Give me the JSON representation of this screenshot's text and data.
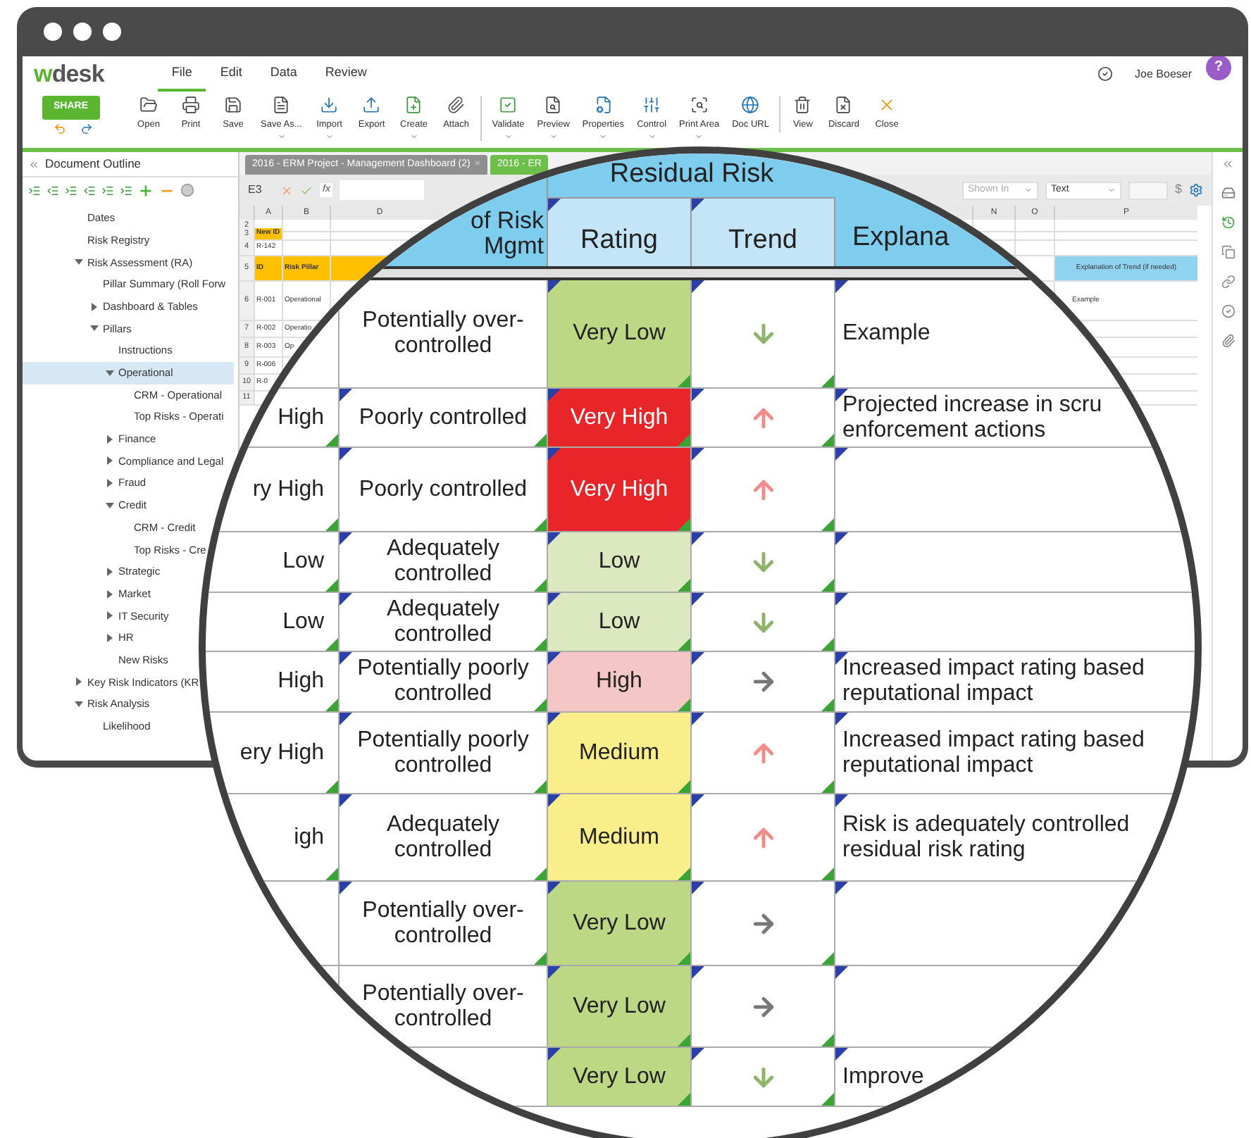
{
  "app": {
    "logo": {
      "accent": "w",
      "rest": "desk"
    },
    "menu": [
      {
        "label": "File",
        "selected": true
      },
      {
        "label": "Edit",
        "selected": false
      },
      {
        "label": "Data",
        "selected": false
      },
      {
        "label": "Review",
        "selected": false
      }
    ],
    "user": "Joe Boeser",
    "help": "?"
  },
  "toolbar": {
    "share": "SHARE",
    "tools": [
      {
        "label": "Open",
        "dropdown": false,
        "separator_before": false
      },
      {
        "label": "Print",
        "dropdown": false,
        "separator_before": false
      },
      {
        "label": "Save",
        "dropdown": false,
        "separator_before": false
      },
      {
        "label": "Save As...",
        "dropdown": true,
        "separator_before": false
      },
      {
        "label": "Import",
        "dropdown": true,
        "separator_before": false
      },
      {
        "label": "Export",
        "dropdown": false,
        "separator_before": false
      },
      {
        "label": "Create",
        "dropdown": true,
        "separator_before": false
      },
      {
        "label": "Attach",
        "dropdown": false,
        "separator_before": false
      },
      {
        "label": "Validate",
        "dropdown": true,
        "separator_before": true
      },
      {
        "label": "Preview",
        "dropdown": true,
        "separator_before": false
      },
      {
        "label": "Properties",
        "dropdown": true,
        "separator_before": false
      },
      {
        "label": "Control",
        "dropdown": true,
        "separator_before": false
      },
      {
        "label": "Print Area",
        "dropdown": true,
        "separator_before": false
      },
      {
        "label": "Doc URL",
        "dropdown": false,
        "separator_before": false
      },
      {
        "label": "View",
        "dropdown": false,
        "separator_before": true
      },
      {
        "label": "Discard",
        "dropdown": false,
        "separator_before": false
      },
      {
        "label": "Close",
        "dropdown": false,
        "separator_before": false
      }
    ]
  },
  "outline": {
    "title": "Document Outline",
    "items": [
      {
        "label": "Dates",
        "selected": false
      },
      {
        "label": "Risk Registry",
        "selected": false
      },
      {
        "label": "Risk Assessment (RA)",
        "selected": false,
        "expanded": true,
        "children": [
          {
            "label": "Pillar Summary (Roll Forw",
            "selected": false
          },
          {
            "label": "Dashboard & Tables",
            "selected": false,
            "expanded": false
          },
          {
            "label": "Pillars",
            "selected": false,
            "expanded": true,
            "children": [
              {
                "label": "Instructions",
                "selected": false
              },
              {
                "label": "Operational",
                "selected": true,
                "expanded": true,
                "children": [
                  {
                    "label": "CRM - Operational",
                    "selected": false
                  },
                  {
                    "label": "Top Risks - Operati",
                    "selected": false
                  }
                ]
              },
              {
                "label": "Finance",
                "selected": false,
                "expanded": false
              },
              {
                "label": "Compliance and Legal",
                "selected": false,
                "expanded": false
              },
              {
                "label": "Fraud",
                "selected": false,
                "expanded": false
              },
              {
                "label": "Credit",
                "selected": false,
                "expanded": true,
                "children": [
                  {
                    "label": "CRM - Credit",
                    "selected": false
                  },
                  {
                    "label": "Top Risks - Cre",
                    "selected": false
                  }
                ]
              },
              {
                "label": "Strategic",
                "selected": false,
                "expanded": false
              },
              {
                "label": "Market",
                "selected": false,
                "expanded": false
              },
              {
                "label": "IT Security",
                "selected": false,
                "expanded": false
              },
              {
                "label": "HR",
                "selected": false,
                "expanded": false
              },
              {
                "label": "New Risks",
                "selected": false
              }
            ]
          }
        ]
      },
      {
        "label": "Key Risk Indicators (KR",
        "selected": false,
        "expanded": false
      },
      {
        "label": "Risk Analysis",
        "selected": false,
        "expanded": true,
        "children": [
          {
            "label": "Likelihood",
            "selected": false
          }
        ]
      }
    ]
  },
  "sheet": {
    "tabs": [
      {
        "label": "2016 - ERM Project - Management Dashboard (2)",
        "selected": false,
        "close": "×"
      },
      {
        "label": "2016 - ER",
        "selected": true
      }
    ],
    "cell_ref": "E3",
    "fx": "fx",
    "filters": [
      {
        "label": "Shown In",
        "muted": true
      },
      {
        "label": "Text",
        "muted": false
      }
    ],
    "currency": "$",
    "columns_left": [
      "A",
      "B",
      "D"
    ],
    "columns_right": [
      "N",
      "O",
      "P"
    ],
    "rows": [
      {
        "number": "2",
        "kind": "plain"
      },
      {
        "number": "3",
        "kind": "tag",
        "A": "New ID"
      },
      {
        "number": "4",
        "kind": "plain",
        "A": "R-142"
      },
      {
        "number": "5",
        "kind": "header",
        "A": "ID",
        "B": "Risk Pillar",
        "P": "Explanation of Trend (if needed)"
      },
      {
        "number": "6",
        "kind": "plain",
        "A": "R-001",
        "B": "Operational",
        "P": "Example"
      },
      {
        "number": "7",
        "kind": "plain",
        "A": "R-002",
        "B": "Operatio"
      },
      {
        "number": "8",
        "kind": "plain",
        "A": "R-003",
        "B": "Op"
      },
      {
        "number": "9",
        "kind": "plain",
        "A": "R-006"
      },
      {
        "number": "10",
        "kind": "plain",
        "A": "R-0"
      },
      {
        "number": "11",
        "kind": "plain"
      }
    ]
  },
  "magnifier": {
    "header": {
      "control": "of Risk Mgmt",
      "group": "Residual Risk",
      "rating": "Rating",
      "trend": "Trend",
      "explanation": "Explana"
    },
    "rows": [
      {
        "control": "Potentially over-controlled",
        "rating": "Very Low",
        "color": "#bdd885",
        "kind": "down",
        "explanation": "Example"
      },
      {
        "risk": "High",
        "control": "Poorly controlled",
        "rating": "Very High",
        "color": "#e8262a",
        "kind": "up",
        "explanation": "Projected increase in scru enforcement actions"
      },
      {
        "risk": "ry High",
        "control": "Poorly controlled",
        "rating": "Very High",
        "color": "#e8262a",
        "kind": "up"
      },
      {
        "risk": "Low",
        "control": "Adequately controlled",
        "rating": "Low",
        "color": "#dbe8c0",
        "kind": "down"
      },
      {
        "risk": "Low",
        "control": "Adequately controlled",
        "rating": "Low",
        "color": "#dbe8c0",
        "kind": "down"
      },
      {
        "risk": "High",
        "control": "Potentially poorly controlled",
        "rating": "High",
        "color": "#f5c6c6",
        "kind": "right",
        "explanation": "Increased impact rating based reputational impact"
      },
      {
        "risk": "ery High",
        "control": "Potentially poorly controlled",
        "rating": "Medium",
        "color": "#f9ee8a",
        "kind": "up",
        "explanation": "Increased impact rating based reputational impact"
      },
      {
        "risk": "igh",
        "control": "Adequately controlled",
        "rating": "Medium",
        "color": "#f9ee8a",
        "kind": "up",
        "explanation": "Risk is adequately controlled residual risk rating"
      },
      {
        "control": "Potentially over-controlled",
        "rating": "Very Low",
        "color": "#bdd885",
        "kind": "right"
      },
      {
        "control": "Potentially over-controlled",
        "rating": "Very Low",
        "color": "#bdd885",
        "kind": "right"
      },
      {
        "rating": "Very Low",
        "color": "#bdd885",
        "kind": "down",
        "explanation": "Improve"
      }
    ]
  }
}
